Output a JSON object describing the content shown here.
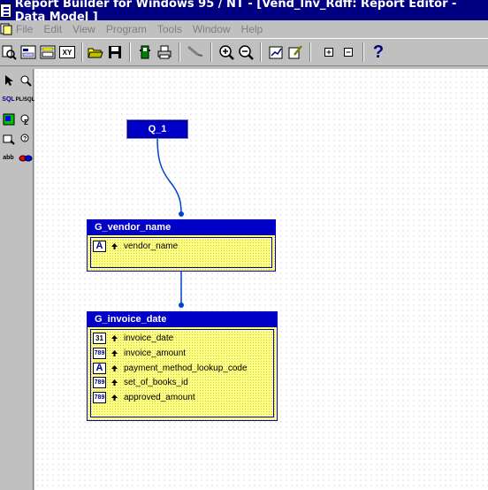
{
  "window": {
    "title": "Report Builder for Windows 95 / NT - [Vend_Inv_Rdff: Report Editor - Data Model ]"
  },
  "menu": [
    "File",
    "Edit",
    "View",
    "Program",
    "Tools",
    "Window",
    "Help"
  ],
  "toolbar": {
    "xy_label": "XY",
    "help_label": "?"
  },
  "palette": {
    "sql_label": "SQL",
    "plsql_label": "PL/SQL",
    "abc_label": "abb"
  },
  "model": {
    "query": {
      "name": "Q_1"
    },
    "groups": [
      {
        "name": "G_vendor_name",
        "columns": [
          {
            "name": "vendor_name",
            "type": "char"
          }
        ]
      },
      {
        "name": "G_invoice_date",
        "columns": [
          {
            "name": "invoice_date",
            "type": "date"
          },
          {
            "name": "invoice_amount",
            "type": "number"
          },
          {
            "name": "payment_method_lookup_code",
            "type": "char"
          },
          {
            "name": "set_of_books_id",
            "type": "number"
          },
          {
            "name": "approved_amount",
            "type": "number"
          }
        ]
      }
    ],
    "type_labels": {
      "char": "A",
      "date": "31",
      "number": "789"
    }
  },
  "colors": {
    "title_bar": "#000080",
    "group_header": "#0000c8",
    "group_body": "#ffff80",
    "link": "#0044cc"
  }
}
